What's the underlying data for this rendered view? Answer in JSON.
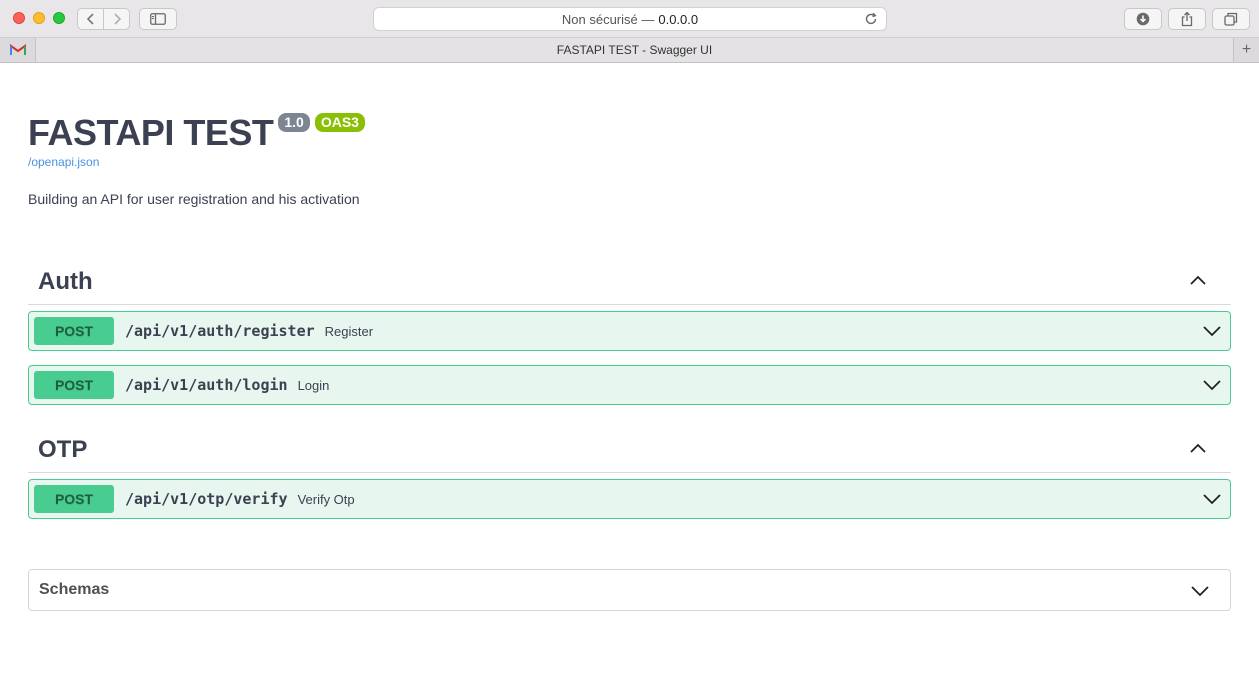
{
  "browser": {
    "url_prefix": "Non sécurisé —",
    "url_host": "0.0.0.0",
    "tab_title": "FASTAPI TEST - Swagger UI",
    "new_tab": "+"
  },
  "info": {
    "title": "FASTAPI TEST",
    "version": "1.0",
    "oas": "OAS3",
    "spec_link": "/openapi.json",
    "description": "Building an API for user registration and his activation"
  },
  "tags": [
    {
      "name": "Auth",
      "operations": [
        {
          "method": "POST",
          "path": "/api/v1/auth/register",
          "summary": "Register"
        },
        {
          "method": "POST",
          "path": "/api/v1/auth/login",
          "summary": "Login"
        }
      ]
    },
    {
      "name": "OTP",
      "operations": [
        {
          "method": "POST",
          "path": "/api/v1/otp/verify",
          "summary": "Verify Otp"
        }
      ]
    }
  ],
  "schemas": {
    "title": "Schemas"
  },
  "colors": {
    "post": "#49cc90",
    "post_bg": "#e8f6f0",
    "version_badge": "#7d8492",
    "oas_badge": "#89bf04",
    "link": "#4990e2"
  }
}
